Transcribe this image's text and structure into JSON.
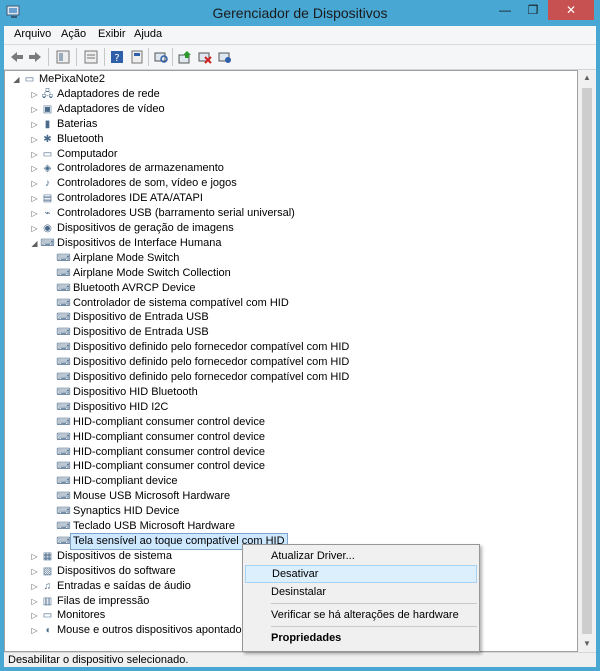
{
  "window": {
    "title": "Gerenciador de Dispositivos",
    "minimize_glyph": "—",
    "maximize_glyph": "❐",
    "close_glyph": "✕"
  },
  "menu": [
    "Arquivo",
    "Ação",
    "Exibir",
    "Ajuda"
  ],
  "toolbar_icons": [
    "back-arrow-icon",
    "forward-arrow-icon",
    "properties-view-icon",
    "list-view-icon",
    "help-icon",
    "help-book-icon",
    "scan-hardware-icon",
    "update-driver-icon",
    "disable-device-icon",
    "uninstall-device-icon"
  ],
  "tree": {
    "root": "MePixaNote2",
    "categories_before": [
      "Adaptadores de rede",
      "Adaptadores de vídeo",
      "Baterias",
      "Bluetooth",
      "Computador",
      "Controladores de armazenamento",
      "Controladores de som, vídeo e jogos",
      "Controladores IDE ATA/ATAPI",
      "Controladores USB (barramento serial universal)",
      "Dispositivos de geração de imagens"
    ],
    "expanded_category": "Dispositivos de Interface Humana",
    "hid_children": [
      "Airplane Mode Switch",
      "Airplane Mode Switch Collection",
      "Bluetooth AVRCP Device",
      "Controlador de sistema compatível com HID",
      "Dispositivo de Entrada USB",
      "Dispositivo de Entrada USB",
      "Dispositivo definido pelo fornecedor compatível com HID",
      "Dispositivo definido pelo fornecedor compatível com HID",
      "Dispositivo definido pelo fornecedor compatível com HID",
      "Dispositivo HID Bluetooth",
      "Dispositivo HID I2C",
      "HID-compliant consumer control device",
      "HID-compliant consumer control device",
      "HID-compliant consumer control device",
      "HID-compliant consumer control device",
      "HID-compliant device",
      "Mouse USB Microsoft Hardware",
      "Synaptics HID Device",
      "Teclado USB Microsoft Hardware",
      "Tela sensível ao toque compatível com HID"
    ],
    "selected_item": "Tela sensível ao toque compatível com HID",
    "categories_after": [
      "Dispositivos de sistema",
      "Dispositivos do software",
      "Entradas e saídas de áudio",
      "Filas de impressão",
      "Monitores",
      "Mouse e outros dispositivos apontadores"
    ]
  },
  "context_menu": {
    "items": [
      "Atualizar Driver...",
      "Desativar",
      "Desinstalar",
      "Verificar se há alterações de hardware",
      "Propriedades"
    ],
    "highlighted": "Desativar"
  },
  "statusbar": "Desabilitar o dispositivo selecionado."
}
